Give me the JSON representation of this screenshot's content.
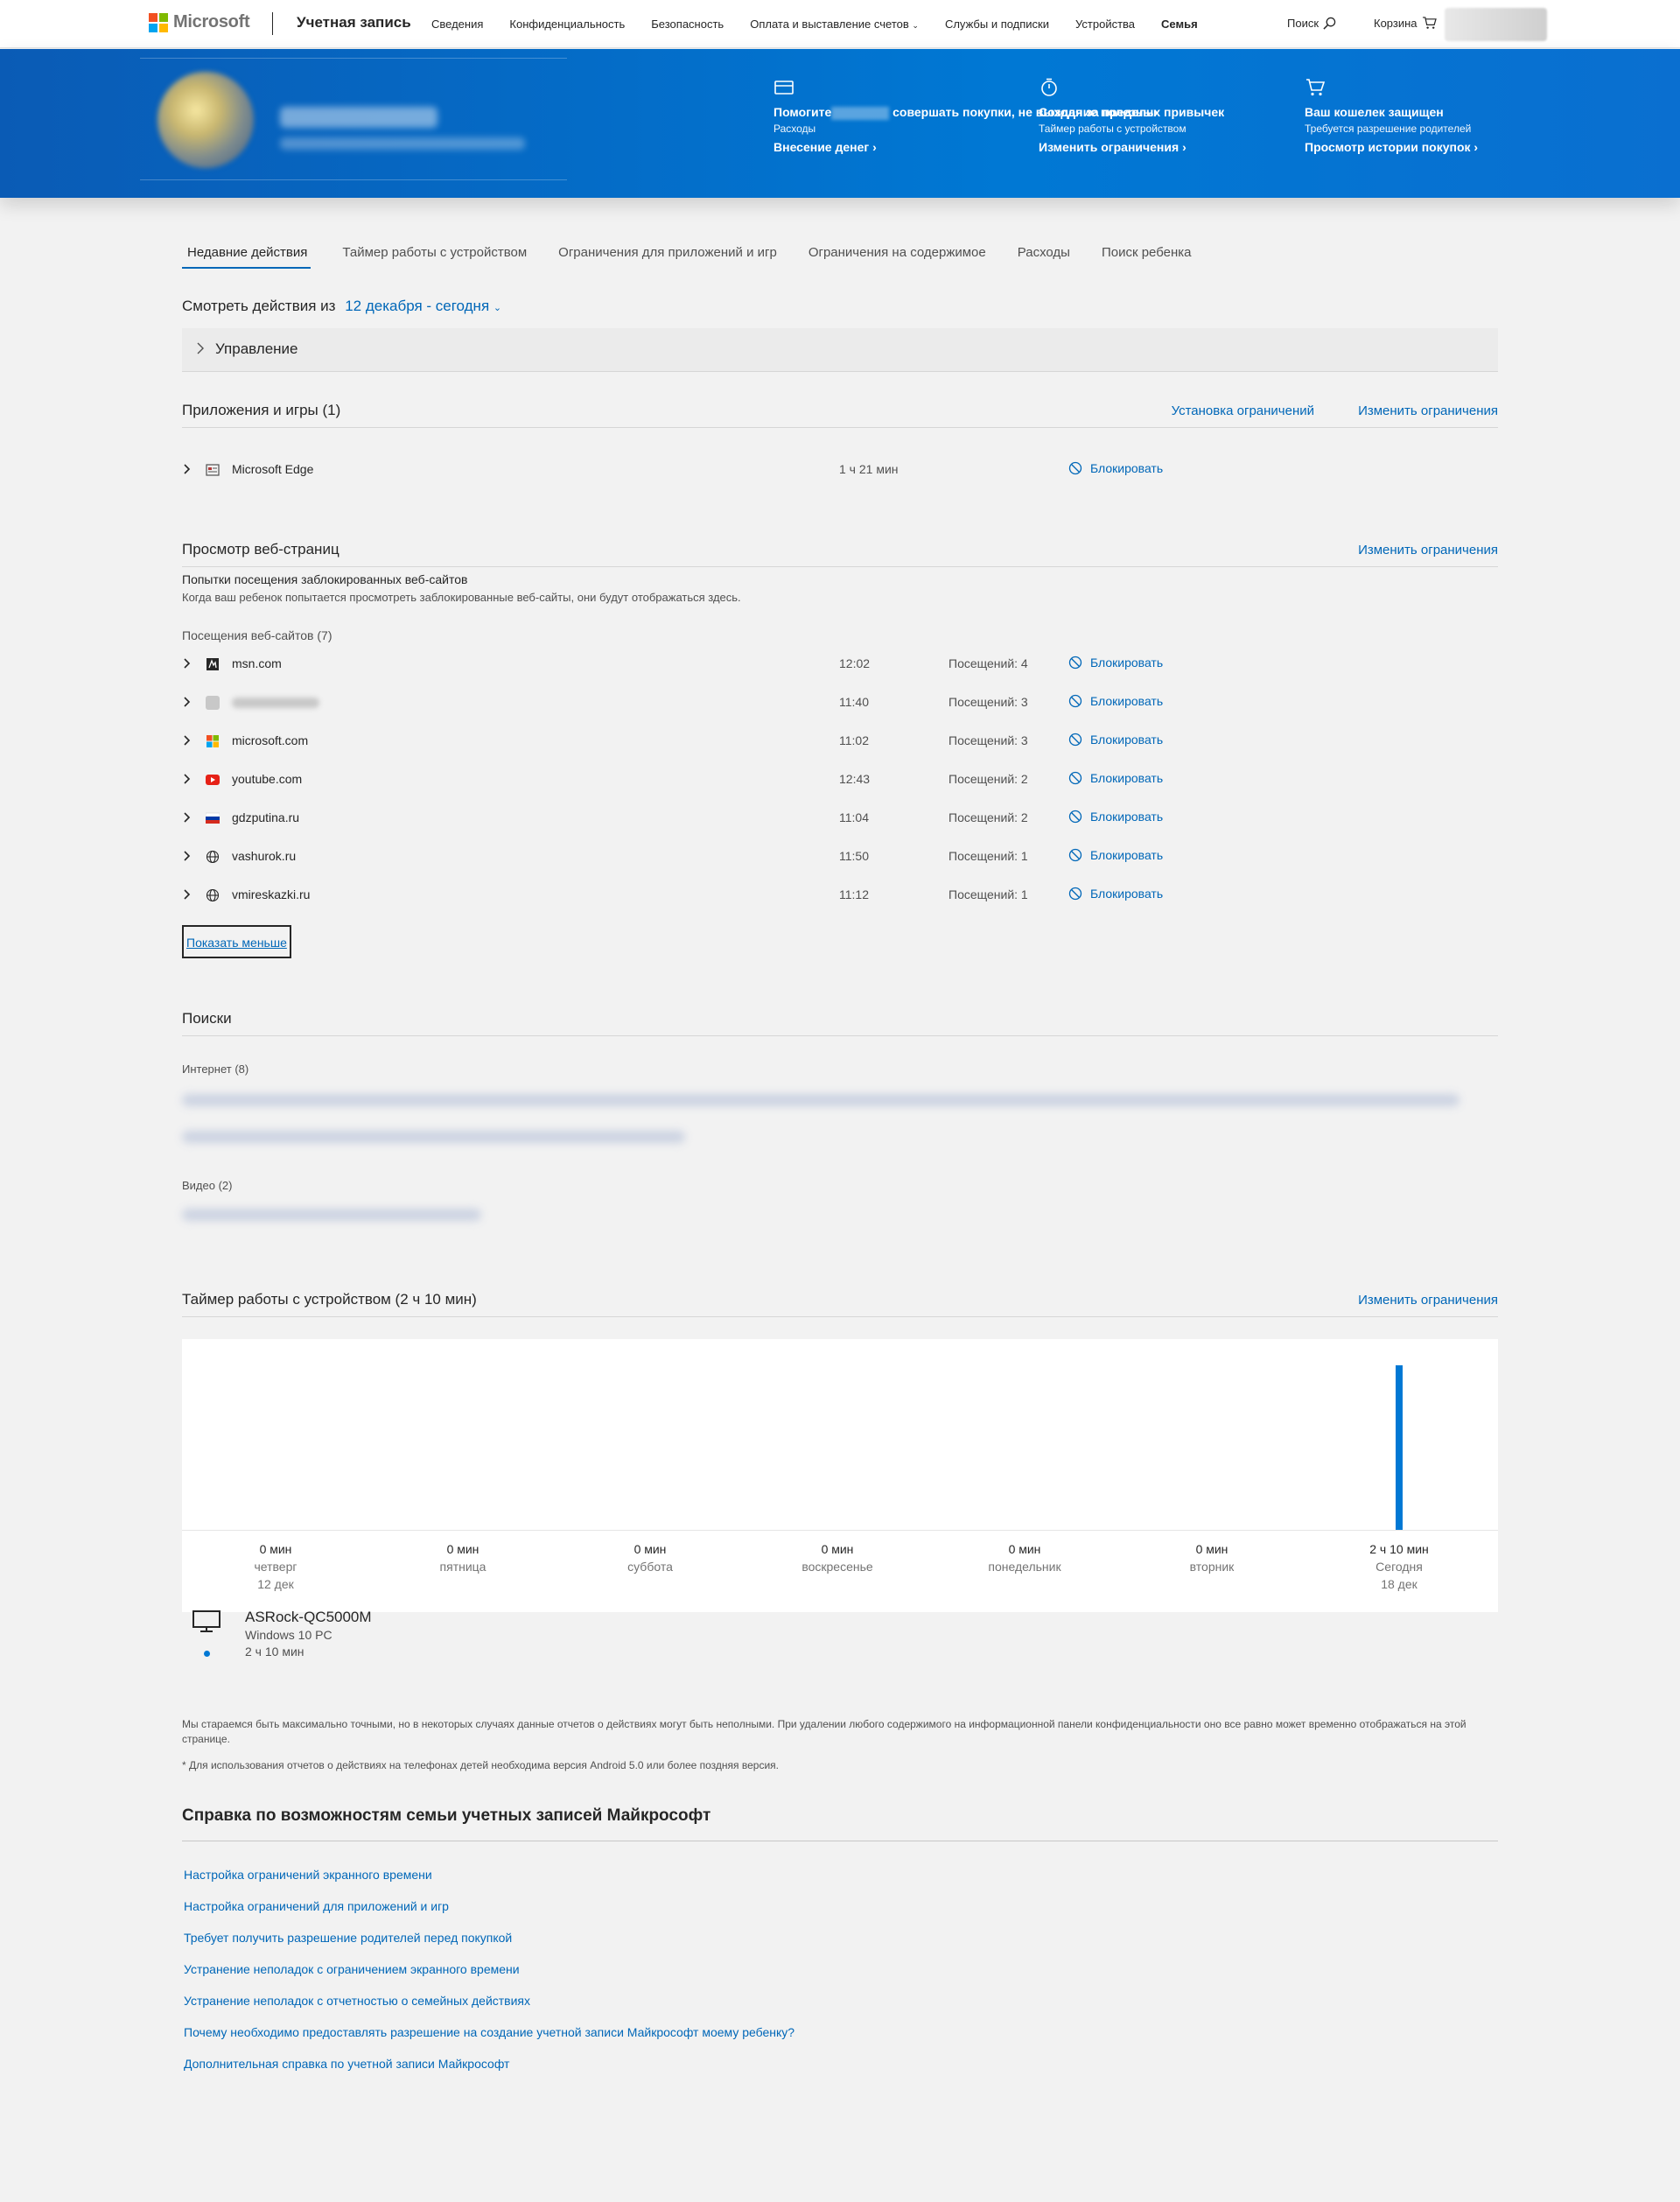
{
  "nav": {
    "logo_text": "Microsoft",
    "account_title": "Учетная запись",
    "links": [
      "Сведения",
      "Конфиденциальность",
      "Безопасность",
      "Оплата и выставление счетов",
      "Службы и подписки",
      "Устройства",
      "Семья"
    ],
    "active_link": "Семья",
    "search_label": "Поиск",
    "cart_label": "Корзина"
  },
  "banner": {
    "features": [
      {
        "icon": "credit-card-icon",
        "title_pre": "Помогите",
        "title_post": " совершать покупки, не выходя за пределы",
        "sub": "Расходы",
        "link": "Внесение денег"
      },
      {
        "icon": "timer-icon",
        "title": "Создание полезных привычек",
        "sub": "Таймер работы с устройством",
        "link": "Изменить ограничения"
      },
      {
        "icon": "shopping-cart-icon",
        "title": "Ваш кошелек защищен",
        "sub": "Требуется разрешение родителей",
        "link": "Просмотр истории покупок"
      }
    ]
  },
  "tabs": [
    "Недавние действия",
    "Таймер работы с устройством",
    "Ограничения для приложений и игр",
    "Ограничения на содержимое",
    "Расходы",
    "Поиск ребенка"
  ],
  "activity": {
    "label": "Смотреть действия из",
    "range": "12 декабря - сегодня"
  },
  "management": {
    "label": "Управление"
  },
  "apps": {
    "title": "Приложения и игры (1)",
    "set_limits": "Установка ограничений",
    "change_limits": "Изменить ограничения",
    "items": [
      {
        "name": "Microsoft Edge",
        "time": "1 ч 21 мин",
        "action": "Блокировать"
      }
    ]
  },
  "web": {
    "title": "Просмотр веб-страниц",
    "change_limits": "Изменить ограничения",
    "blocked_title": "Попытки посещения заблокированных веб-сайтов",
    "blocked_desc": "Когда ваш ребенок попытается просмотреть заблокированные веб-сайты, они будут отображаться здесь.",
    "visits_title": "Посещения веб-сайтов (7)",
    "sites": [
      {
        "name": "msn.com",
        "time": "12:02",
        "visits": "Посещений: 4",
        "action": "Блокировать",
        "icon": "msn-icon"
      },
      {
        "name": "",
        "time": "11:40",
        "visits": "Посещений: 3",
        "action": "Блокировать",
        "icon": "redacted-site-icon"
      },
      {
        "name": "microsoft.com",
        "time": "11:02",
        "visits": "Посещений: 3",
        "action": "Блокировать",
        "icon": "microsoft-icon"
      },
      {
        "name": "youtube.com",
        "time": "12:43",
        "visits": "Посещений: 2",
        "action": "Блокировать",
        "icon": "youtube-icon"
      },
      {
        "name": "gdzputina.ru",
        "time": "11:04",
        "visits": "Посещений: 2",
        "action": "Блокировать",
        "icon": "flag-icon"
      },
      {
        "name": "vashurok.ru",
        "time": "11:50",
        "visits": "Посещений: 1",
        "action": "Блокировать",
        "icon": "globe-icon"
      },
      {
        "name": "vmireskazki.ru",
        "time": "11:12",
        "visits": "Посещений: 1",
        "action": "Блокировать",
        "icon": "globe-icon"
      }
    ],
    "show_less": "Показать меньше"
  },
  "searches": {
    "title": "Поиски",
    "internet_label": "Интернет (8)",
    "video_label": "Видео (2)"
  },
  "screen_time": {
    "title": "Таймер работы с устройством (2 ч 10 мин)",
    "change_limits": "Изменить ограничения",
    "device_name": "ASRock-QC5000M",
    "device_type": "Windows 10 PC",
    "device_time": "2 ч 10 мин"
  },
  "chart_data": {
    "type": "bar",
    "categories": [
      "четверг 12 дек",
      "пятница",
      "суббота",
      "воскресенье",
      "понедельник",
      "вторник",
      "Сегодня 18 дек"
    ],
    "values": [
      0,
      0,
      0,
      0,
      0,
      0,
      130
    ],
    "value_labels": [
      "0 мин",
      "0 мин",
      "0 мин",
      "0 мин",
      "0 мин",
      "0 мин",
      "2 ч 10 мин"
    ],
    "day_labels": [
      "четверг",
      "пятница",
      "суббота",
      "воскресенье",
      "понедельник",
      "вторник",
      "Сегодня"
    ],
    "date_labels": [
      "12 дек",
      "",
      "",
      "",
      "",
      "",
      "18 дек"
    ],
    "color": "#0078d4",
    "title": "",
    "xlabel": "",
    "ylabel": ""
  },
  "disclaimers": [
    "Мы стараемся быть максимально точными, но в некоторых случаях данные отчетов о действиях могут быть неполными. При удалении любого содержимого на информационной панели конфиденциальности оно все равно может временно отображаться на этой странице.",
    "* Для использования отчетов о действиях на телефонах детей необходима версия Android 5.0 или более поздняя версия."
  ],
  "help": {
    "title": "Справка по возможностям семьи учетных записей Майкрософт",
    "links": [
      "Настройка ограничений экранного времени",
      "Настройка ограничений для приложений и игр",
      "Требует получить разрешение родителей перед покупкой",
      "Устранение неполадок с ограничением экранного времени",
      "Устранение неполадок с отчетностью о семейных действиях",
      "Почему необходимо предоставлять разрешение на создание учетной записи Майкрософт моему ребенку?",
      "Дополнительная справка по учетной записи Майкрософт"
    ]
  },
  "colors": {
    "accent": "#0067b8",
    "banner": "#0078d4",
    "ms_red": "#f25022",
    "ms_green": "#7fba00",
    "ms_blue": "#00a4ef",
    "ms_yellow": "#ffb900"
  }
}
